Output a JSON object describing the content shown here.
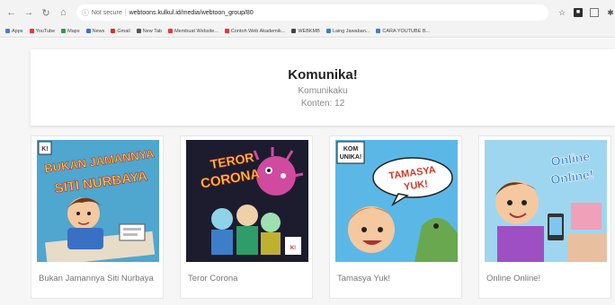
{
  "browser": {
    "security_label": "Not secure",
    "url": "webtoons.kulkul.id/media/webtoon_group/80",
    "bookmarks": [
      "Apps",
      "YouTube",
      "Maps",
      "News",
      "Gmail",
      "New Tab",
      "Membuat Website...",
      "Contoh Web Akademik...",
      "WEBKMB",
      "Laing Jawaban...",
      "CARA YOUTUBE B..."
    ]
  },
  "group": {
    "title": "Komunika!",
    "author": "Komunikaku",
    "count": "Konten: 12"
  },
  "cards": [
    {
      "title": "Bukan Jamannya Siti Nurbaya",
      "cover_text": "BUKAN JAMANNYA SITI NURBAYA"
    },
    {
      "title": "Teror Corona",
      "cover_text": "TEROR CORONA"
    },
    {
      "title": "Tamasya Yuk!",
      "cover_text": "TAMASYA YUK!"
    },
    {
      "title": "Online Online!",
      "cover_text": "Online Online!"
    }
  ],
  "colors": {
    "page_bg": "#f6f6f6",
    "card_bg": "#ffffff",
    "title_color": "#222222",
    "muted": "#888888"
  }
}
